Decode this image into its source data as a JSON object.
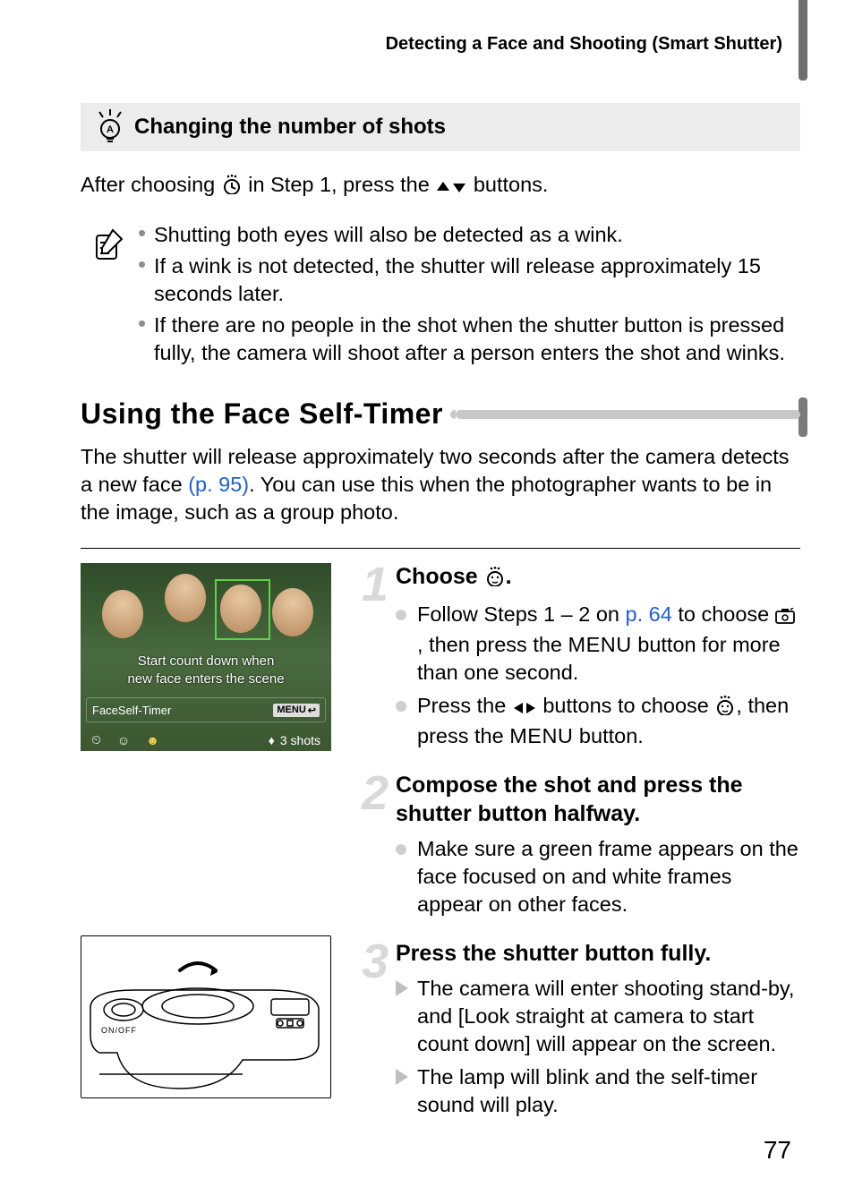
{
  "running_head": "Detecting a Face and Shooting (Smart Shutter)",
  "tip": {
    "title": "Changing the number of shots",
    "line_before": "After choosing ",
    "line_after": " in Step 1, press the ",
    "line_end": " buttons."
  },
  "notes": [
    "Shutting both eyes will also be detected as a wink.",
    "If a wink is not detected, the shutter will release approximately 15 seconds later.",
    "If there are no people in the shot when the shutter button is pressed fully, the camera will shoot after a person enters the shot and winks."
  ],
  "section_title": "Using the Face Self-Timer",
  "intro": {
    "part1": "The shutter will release approximately two seconds after the camera detects a new face ",
    "link": "(p. 95)",
    "part2": ". You can use this when the photographer wants to be in the image, such as a group photo."
  },
  "screenshot": {
    "msg_line1": "Start count down when",
    "msg_line2": "new face enters the scene",
    "mode_label": "FaceSelf-Timer",
    "menu_label": "MENU",
    "shots_label": "3 shots"
  },
  "camera": {
    "onoff": "ON/OFF"
  },
  "steps": [
    {
      "num": "1",
      "title_before": "Choose ",
      "title_after": ".",
      "items": [
        {
          "type": "dot",
          "t1": "Follow Steps 1 – 2 on ",
          "link": "p. 64",
          "t2": " to choose ",
          "t3": ", then press the ",
          "menu": "MENU",
          "t4": " button for more than one second."
        },
        {
          "type": "dot",
          "t1": "Press the ",
          "t2": " buttons to choose ",
          "t3": ", then press the ",
          "menu": "MENU",
          "t4": " button."
        }
      ]
    },
    {
      "num": "2",
      "title": "Compose the shot and press the shutter button halfway.",
      "items": [
        {
          "type": "dot",
          "text": "Make sure a green frame appears on the face focused on and white frames appear on other faces."
        }
      ]
    },
    {
      "num": "3",
      "title": "Press the shutter button fully.",
      "items": [
        {
          "type": "arrow",
          "text": "The camera will enter shooting stand-by, and [Look straight at camera to start count down] will appear on the screen."
        },
        {
          "type": "arrow",
          "text": "The lamp will blink and the self-timer sound will play."
        }
      ]
    }
  ],
  "page_number": "77"
}
